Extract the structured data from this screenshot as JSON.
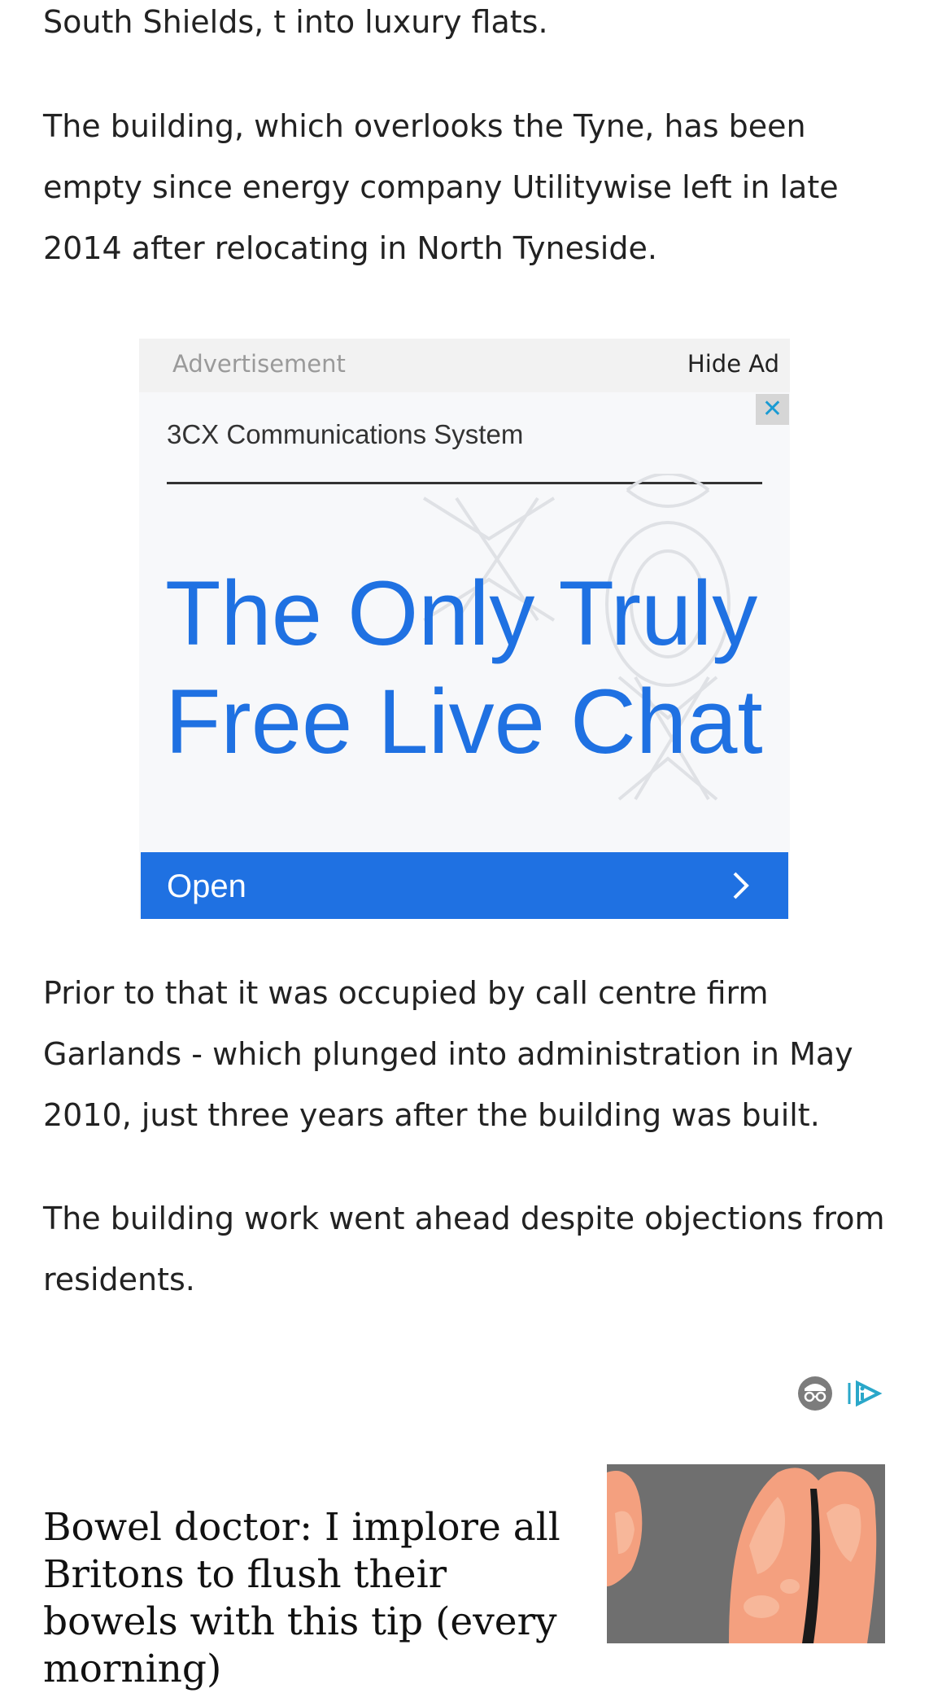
{
  "article": {
    "paragraphs": [
      "South Shields, t into luxury flats.",
      "The building, which overlooks the Tyne, has been empty since energy company Utilitywise left in late 2014 after relocating in North Tyneside.",
      "Prior to that it was occupied by call centre firm Garlands - which plunged into administration in May 2010, just three years after the building was built.",
      "The building work went ahead despite objections from residents."
    ]
  },
  "advertisement": {
    "label": "Advertisement",
    "hide_label": "Hide Ad",
    "close_glyph": "✕",
    "brand": "3CX Communications System",
    "headline_line1": "The Only Truly",
    "headline_line2": "Free Live Chat",
    "cta_label": "Open",
    "accent_color": "#1f71e2"
  },
  "sponsored": {
    "title": "Bowel doctor: I implore all Britons to flush their bowels with this tip (every morning)",
    "privacy_icon": "privacy-icon",
    "adchoices_icon": "adchoices-icon"
  }
}
